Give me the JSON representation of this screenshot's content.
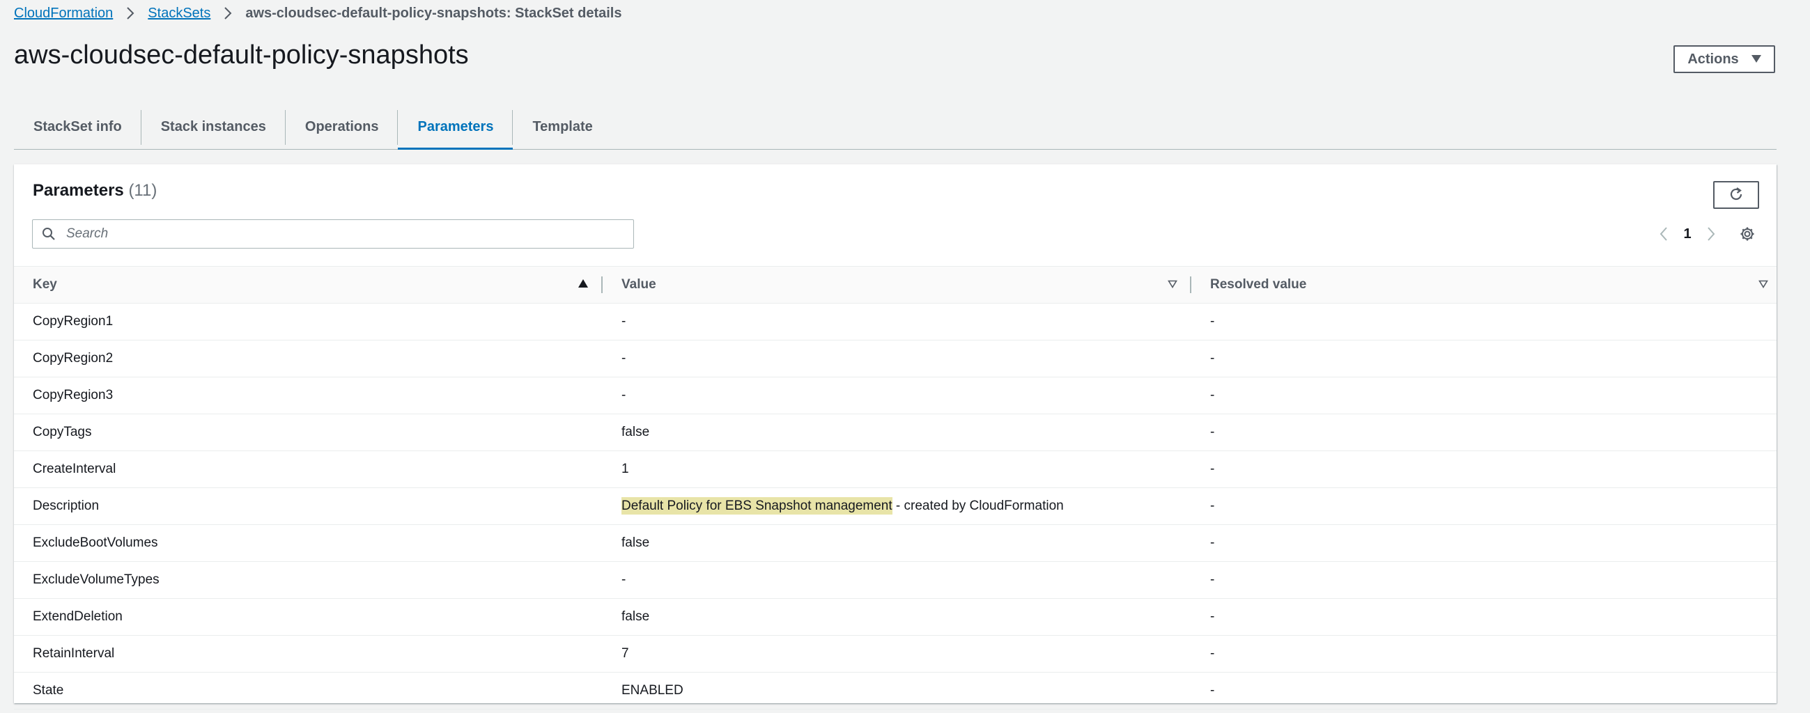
{
  "breadcrumb": {
    "items": [
      "CloudFormation",
      "StackSets"
    ],
    "current": "aws-cloudsec-default-policy-snapshots: StackSet details"
  },
  "page": {
    "title": "aws-cloudsec-default-policy-snapshots",
    "actions_label": "Actions"
  },
  "tabs": [
    "StackSet info",
    "Stack instances",
    "Operations",
    "Parameters",
    "Template"
  ],
  "active_tab": "Parameters",
  "panel": {
    "title": "Parameters",
    "count": "(11)",
    "search_placeholder": "Search",
    "page_number": "1"
  },
  "table": {
    "columns": [
      "Key",
      "Value",
      "Resolved value"
    ],
    "rows": [
      {
        "key": "CopyRegion1",
        "value": "-",
        "resolved": "-"
      },
      {
        "key": "CopyRegion2",
        "value": "-",
        "resolved": "-"
      },
      {
        "key": "CopyRegion3",
        "value": "-",
        "resolved": "-"
      },
      {
        "key": "CopyTags",
        "value": "false",
        "resolved": "-"
      },
      {
        "key": "CreateInterval",
        "value": "1",
        "resolved": "-"
      },
      {
        "key": "Description",
        "value_highlight": "Default Policy for EBS Snapshot management",
        "value": " - created by CloudFormation",
        "resolved": "-"
      },
      {
        "key": "ExcludeBootVolumes",
        "value": "false",
        "resolved": "-"
      },
      {
        "key": "ExcludeVolumeTypes",
        "value": "-",
        "resolved": "-"
      },
      {
        "key": "ExtendDeletion",
        "value": "false",
        "resolved": "-"
      },
      {
        "key": "RetainInterval",
        "value": "7",
        "resolved": "-"
      },
      {
        "key": "State",
        "value": "ENABLED",
        "resolved": "-"
      }
    ]
  },
  "colors": {
    "link": "#0073bb",
    "active_tab": "#0073bb",
    "highlight": "#e8e4a8",
    "background": "#f2f3f3"
  },
  "icons": {
    "breadcrumb_separator": "chevron-right-icon",
    "actions": "caret-down-icon",
    "refresh": "refresh-icon",
    "search": "search-icon",
    "pager_prev": "chevron-left-icon",
    "pager_next": "chevron-right-icon",
    "settings": "gear-icon",
    "sort_asc": "sort-ascending-icon",
    "sort_none": "sort-descending-outline-icon"
  }
}
